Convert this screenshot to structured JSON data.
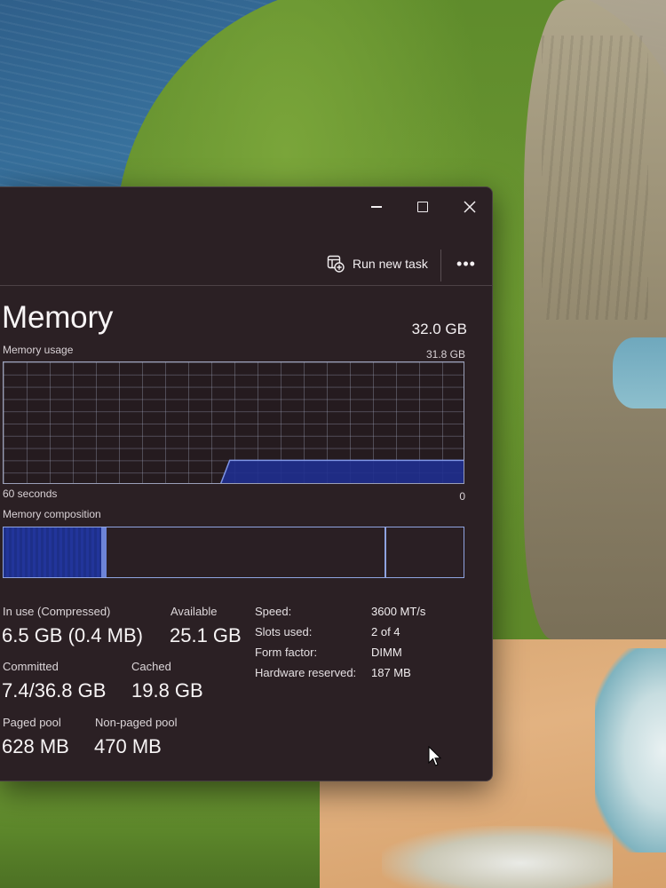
{
  "window": {
    "toolbar": {
      "run_new_task_label": "Run new task",
      "more_label": "•••"
    },
    "page_title": "Memory",
    "total_memory": "32.0 GB",
    "usage_graph": {
      "label": "Memory usage",
      "max_label": "31.8 GB",
      "time_label": "60 seconds",
      "min_label": "0",
      "history_fraction": [
        0,
        0,
        0,
        0,
        0,
        0,
        0,
        0,
        0,
        0,
        0,
        0,
        0,
        0,
        0,
        0,
        0,
        0,
        0,
        0,
        0,
        0,
        0,
        0,
        0.2,
        0.2,
        0.2,
        0.2,
        0.2,
        0.2,
        0.2,
        0.2,
        0.2,
        0.2,
        0.2,
        0.2,
        0.2,
        0.2,
        0.2,
        0.2,
        0.2,
        0.2,
        0.2,
        0.2,
        0.2,
        0.2,
        0.2,
        0.2,
        0.2,
        0.2
      ],
      "colors": {
        "fill": "#1f2f8f",
        "line": "#7f95e6",
        "grid": "#a0a5be"
      }
    },
    "composition": {
      "label": "Memory composition",
      "in_use_fraction": 0.22,
      "compressed_fraction": 0.0125,
      "modified_end_fraction": 0.83
    },
    "stats": {
      "in_use_label": "In use (Compressed)",
      "in_use_value": "6.5 GB (0.4 MB)",
      "available_label": "Available",
      "available_value": "25.1 GB",
      "committed_label": "Committed",
      "committed_value": "7.4/36.8 GB",
      "cached_label": "Cached",
      "cached_value": "19.8 GB",
      "paged_pool_label": "Paged pool",
      "paged_pool_value": "628 MB",
      "non_paged_pool_label": "Non-paged pool",
      "non_paged_pool_value": "470 MB"
    },
    "specs": {
      "speed_label": "Speed:",
      "speed_value": "3600 MT/s",
      "slots_label": "Slots used:",
      "slots_value": "2 of 4",
      "form_factor_label": "Form factor:",
      "form_factor_value": "DIMM",
      "hw_reserved_label": "Hardware reserved:",
      "hw_reserved_value": "187 MB"
    }
  }
}
